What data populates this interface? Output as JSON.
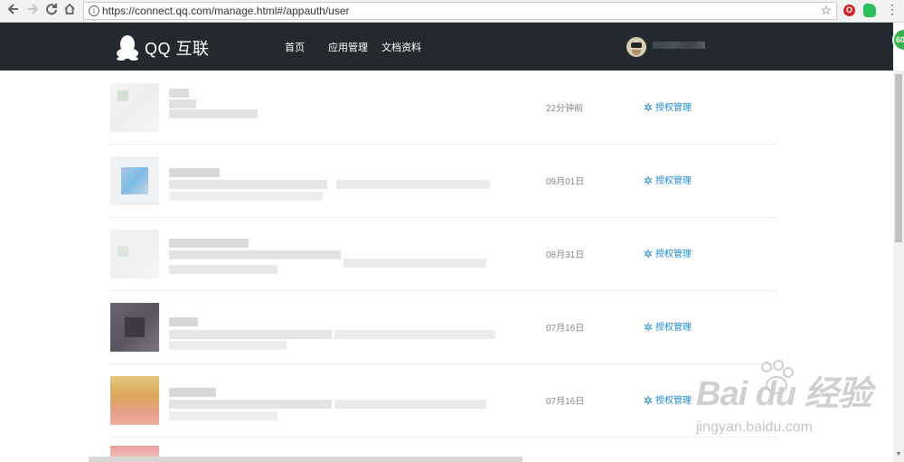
{
  "browser": {
    "url": "https://connect.qq.com/manage.html#/appauth/user",
    "back_icon": "arrow-left-icon",
    "forward_icon": "arrow-right-icon",
    "reload_icon": "reload-icon",
    "home_icon": "home-icon",
    "info_glyph": "i",
    "star_glyph": "☆",
    "menu_glyph": "⋮",
    "opera_glyph": "O"
  },
  "header": {
    "logo_text": "QQ 互联",
    "nav": [
      "首页",
      "应用管理",
      "文档资料"
    ],
    "bg_color": "#23292f"
  },
  "badge": {
    "text": "60"
  },
  "apps": [
    {
      "date": "22分钟前",
      "action": "授权管理"
    },
    {
      "date": "09月01日",
      "action": "授权管理"
    },
    {
      "date": "08月31日",
      "action": "授权管理"
    },
    {
      "date": "07月16日",
      "action": "授权管理"
    },
    {
      "date": "07月16日",
      "action": "授权管理"
    }
  ],
  "watermark": {
    "brand": "Bai  du 经验",
    "url": "jingyan.baidu.com"
  },
  "accent_color": "#1a8ad0"
}
